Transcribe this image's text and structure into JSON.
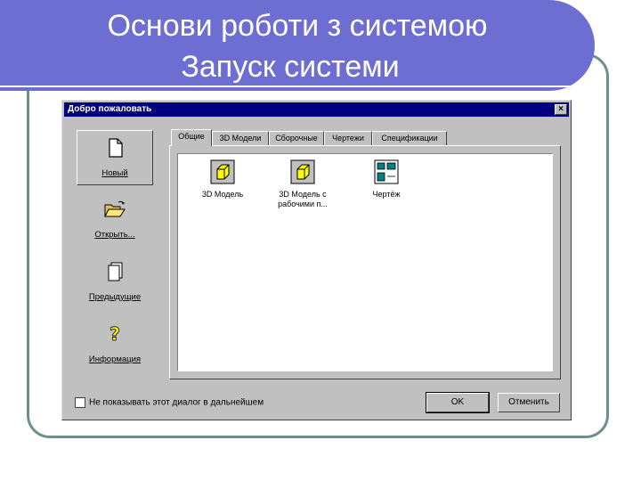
{
  "slide": {
    "title_line1": "Основи роботи з системою",
    "title_line2": "Запуск системи",
    "colors": {
      "title_bg": "#6e6ed2",
      "frame": "#6d8f8f"
    }
  },
  "dialog": {
    "caption": "Добро пожаловать",
    "close_label": "×",
    "left_nav": [
      {
        "label": "Новый",
        "icon": "new-document-icon",
        "active": true
      },
      {
        "label": "Открыть...",
        "icon": "open-folder-icon"
      },
      {
        "label": "Предыдущие",
        "icon": "previous-documents-icon"
      },
      {
        "label": "Информация",
        "icon": "help-question-icon"
      }
    ],
    "tabs": [
      "Общие",
      "3D Модели",
      "Сборочные",
      "Чертежи",
      "Спецификации"
    ],
    "active_tab": "Общие",
    "templates": [
      {
        "line1": "3D Модель",
        "line2": "",
        "icon": "3d-model-cube-icon"
      },
      {
        "line1": "3D Модель с",
        "line2": "рабочими п...",
        "icon": "3d-model-cube-icon"
      },
      {
        "line1": "Чертёж",
        "line2": "",
        "icon": "drawing-icon"
      }
    ],
    "checkbox_label": "Не показывать этот диалог в дальнейшем",
    "ok_label": "OK",
    "cancel_label": "Отменить",
    "colors": {
      "caption_bg": "#000080",
      "face": "#c0c0c0",
      "cube": "#ffff00"
    }
  }
}
